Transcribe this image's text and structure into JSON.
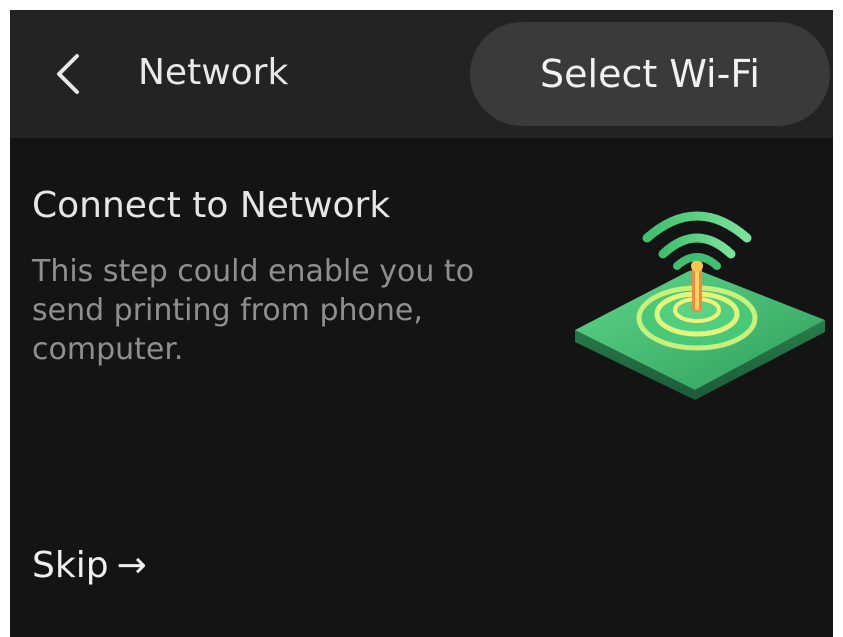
{
  "header": {
    "back_icon": "chevron-left-icon",
    "title": "Network",
    "select_wifi_label": "Select Wi-Fi"
  },
  "content": {
    "title": "Connect to Network",
    "description": "This step could enable you to send printing from phone, computer.",
    "illustration_icon": "wifi-router-icon"
  },
  "footer": {
    "skip_label": "Skip",
    "skip_arrow": "→"
  },
  "colors": {
    "background": "#141414",
    "header_background": "#232323",
    "button_background": "#3a3a3a",
    "accent_green": "#3fbf6f"
  }
}
